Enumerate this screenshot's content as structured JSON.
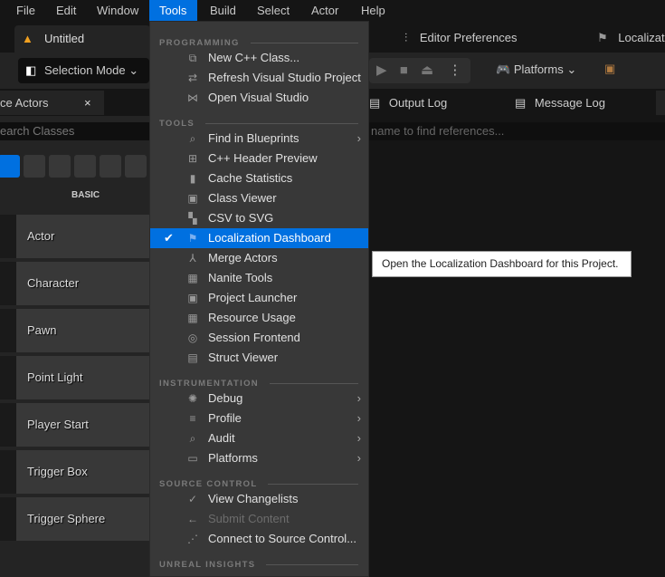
{
  "menubar": {
    "items": [
      "File",
      "Edit",
      "Window",
      "Tools",
      "Build",
      "Select",
      "Actor",
      "Help"
    ],
    "active": "Tools"
  },
  "tabs": {
    "document": "Untitled",
    "editor_prefs": "Editor Preferences",
    "localization": "Localizati"
  },
  "toolbar": {
    "selection_mode": "Selection Mode",
    "platforms": "Platforms"
  },
  "left_panel": {
    "tab": "ce Actors",
    "close": "×",
    "search_placeholder": "earch Classes",
    "category": "BASIC",
    "items": [
      "Actor",
      "Character",
      "Pawn",
      "Point Light",
      "Player Start",
      "Trigger Box",
      "Trigger Sphere"
    ]
  },
  "right_panel": {
    "tabs": [
      "Output Log",
      "Message Log"
    ],
    "search_placeholder": "name to find references..."
  },
  "menu": {
    "sections": [
      "PROGRAMMING",
      "TOOLS",
      "INSTRUMENTATION",
      "SOURCE CONTROL",
      "UNREAL INSIGHTS"
    ],
    "programming": [
      {
        "label": "New C++ Class...",
        "icon": "class-icon"
      },
      {
        "label": "Refresh Visual Studio Project",
        "icon": "refresh-vs-icon"
      },
      {
        "label": "Open Visual Studio",
        "icon": "visual-studio-icon"
      }
    ],
    "tools": [
      {
        "label": "Find in Blueprints",
        "icon": "find-icon",
        "submenu": true
      },
      {
        "label": "C++ Header Preview",
        "icon": "header-icon"
      },
      {
        "label": "Cache Statistics",
        "icon": "stats-icon"
      },
      {
        "label": "Class Viewer",
        "icon": "class-viewer-icon"
      },
      {
        "label": "CSV to SVG",
        "icon": "csv-icon"
      },
      {
        "label": "Localization Dashboard",
        "icon": "flag-icon",
        "selected": true
      },
      {
        "label": "Merge Actors",
        "icon": "merge-icon"
      },
      {
        "label": "Nanite Tools",
        "icon": "nanite-icon"
      },
      {
        "label": "Project Launcher",
        "icon": "launcher-icon"
      },
      {
        "label": "Resource Usage",
        "icon": "table-icon"
      },
      {
        "label": "Session Frontend",
        "icon": "session-icon"
      },
      {
        "label": "Struct Viewer",
        "icon": "struct-icon"
      }
    ],
    "instrumentation": [
      {
        "label": "Debug",
        "icon": "bug-icon",
        "submenu": true
      },
      {
        "label": "Profile",
        "icon": "profile-icon",
        "submenu": true
      },
      {
        "label": "Audit",
        "icon": "audit-icon",
        "submenu": true
      },
      {
        "label": "Platforms",
        "icon": "platforms-icon",
        "submenu": true
      }
    ],
    "source_control": [
      {
        "label": "View Changelists",
        "icon": "check-circle-icon"
      },
      {
        "label": "Submit Content",
        "icon": "arrow-left-icon",
        "disabled": true
      },
      {
        "label": "Connect to Source Control...",
        "icon": "source-control-icon"
      }
    ]
  },
  "tooltip": "Open the Localization Dashboard for this Project.",
  "colors": {
    "accent": "#0070e0",
    "menu_bg": "#383838",
    "app_bg": "#151515"
  }
}
